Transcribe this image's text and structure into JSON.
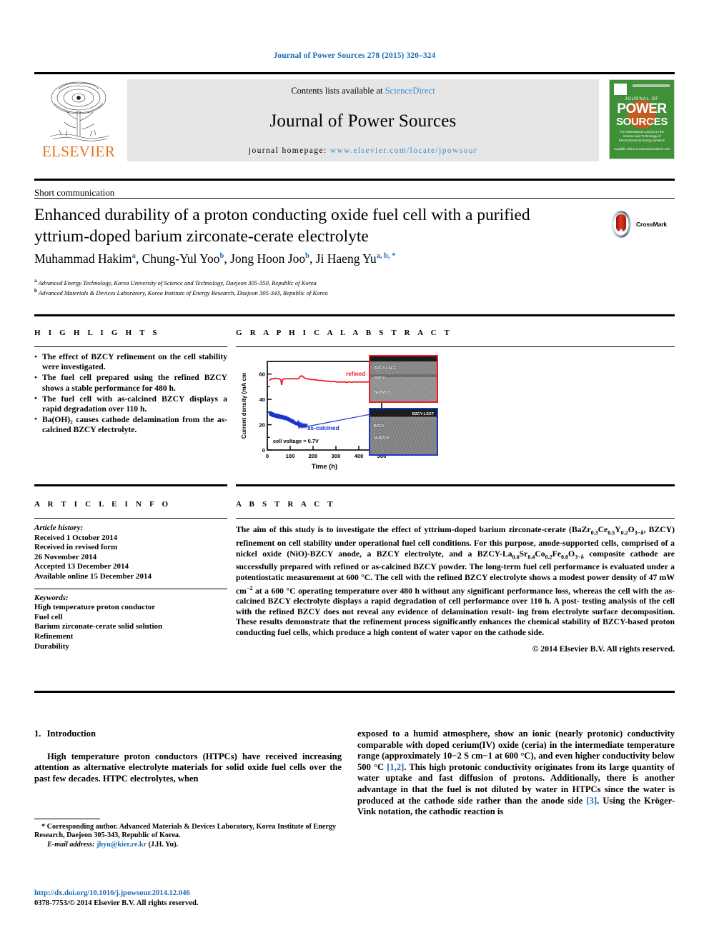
{
  "running_head": "Journal of Power Sources 278 (2015) 320–324",
  "masthead": {
    "publisher": "ELSEVIER",
    "contents_prefix": "Contents lists available at ",
    "contents_link": "ScienceDirect",
    "journal_name": "Journal of Power Sources",
    "homepage_prefix": "journal homepage: ",
    "homepage_url": "www.elsevier.com/locate/jpowsour",
    "cover": {
      "journal_of": "JOURNAL OF",
      "power": "POWER",
      "sources": "SOURCES",
      "subtitle": "The International Journal on the Science and Technology of Electrochemical Energy Systems",
      "footer": "Available online at www.sciencedirect.com"
    }
  },
  "article": {
    "category": "Short communication",
    "title": "Enhanced durability of a proton conducting oxide fuel cell with a purified yttrium-doped barium zirconate-cerate electrolyte",
    "crossmark_label": "CrossMark",
    "authors": [
      {
        "name": "Muhammad Hakim",
        "sup": "a"
      },
      {
        "name": "Chung-Yul Yoo",
        "sup": "b"
      },
      {
        "name": "Jong Hoon Joo",
        "sup": "b"
      },
      {
        "name": "Ji Haeng Yu",
        "sup": "a, b, *"
      }
    ],
    "affiliations": [
      {
        "marker": "a",
        "text": "Advanced Energy Technology, Korea University of Science and Technology, Daejeon 305-350, Republic of Korea"
      },
      {
        "marker": "b",
        "text": "Advanced Materials & Devices Laboratory, Korea Institute of Energy Research, Daejeon 305-343, Republic of Korea"
      }
    ]
  },
  "highlights": {
    "heading": "H I G H L I G H T S",
    "items": [
      "The effect of BZCY refinement on the cell stability were investigated.",
      "The fuel cell prepared using the refined BZCY shows a stable performance for 480 h.",
      "The fuel cell with as-calcined BZCY displays a rapid degradation over 110 h.",
      "Ba(OH)₂ causes cathode delamination from the as-calcined BZCY electrolyte."
    ]
  },
  "graphical_abstract": {
    "heading": "G R A P H I C A L   A B S T R A C T"
  },
  "article_info": {
    "heading": "A R T I C L E    I N F O",
    "history_label": "Article history:",
    "history": [
      "Received 1 October 2014",
      "Received in revised form",
      "26 November 2014",
      "Accepted 13 December 2014",
      "Available online 15 December 2014"
    ],
    "keywords_label": "Keywords:",
    "keywords": [
      "High temperature proton conductor",
      "Fuel cell",
      "Barium zirconate-cerate solid solution",
      "Refinement",
      "Durability"
    ]
  },
  "abstract": {
    "heading": "A B S T R A C T",
    "paragraphs": [
      "The aim of this study is to investigate the effect of yttrium-doped barium zirconate-cerate (BaZr0.3Ce0.5Y0.2O3−δ, BZCY) refinement on cell stability under operational fuel cell conditions. For this purpose, anode-supported cells, comprised of a nickel oxide (NiO)-BZCY anode, a BZCY electrolyte, and a BZCY-La0.6Sr0.4Co0.2Fe0.8O3−δ composite cathode are successfully prepared with refined or as-calcined BZCY powder. The long-term fuel cell performance is evaluated under a potentiostatic measurement at 600 °C. The cell with the refined BZCY electrolyte shows a modest power density of 47 mW cm−2 at a 600 °C operating temperature over 480 h without any significant performance loss, whereas the cell with the as-calcined BZCY electrolyte displays a rapid degradation of cell performance over 110 h. A post-testing analysis of the cell with the refined BZCY does not reveal any evidence of delamination resulting from electrolyte surface decomposition. These results demonstrate that the refinement process significantly enhances the chemical stability of BZCY-based proton conducting fuel cells, which produce a high content of water vapor on the cathode side."
    ],
    "copyright": "© 2014 Elsevier B.V. All rights reserved."
  },
  "introduction": {
    "number": "1.",
    "heading": "Introduction",
    "left_paragraph": "High temperature proton conductors (HTPCs) have received increasing attention as alternative electrolyte materials for solid oxide fuel cells over the past few decades. HTPC electrolytes, when",
    "right_paragraph_parts": [
      "exposed to a humid atmosphere, show an ionic (nearly protonic) conductivity comparable with doped cerium(IV) oxide (ceria) in the intermediate temperature range (approximately 10−2 S cm−1 at 600 °C), and even higher conductivity below 500 °C ",
      "[1,2]",
      ". This high protonic conductivity originates from its large quantity of water uptake and fast diffusion of protons. Additionally, there is another advantage in that the fuel is not diluted by water in HTPCs since the water is produced at the cathode side rather than the anode side ",
      "[3]",
      ". Using the Kröger-Vink notation, the cathodic reaction is"
    ]
  },
  "footnote": {
    "corresponding": "* Corresponding author. Advanced Materials & Devices Laboratory, Korea Institute of Energy Research, Daejeon 305-343, Republic of Korea.",
    "email_label": "E-mail address:",
    "email": "jhyu@kier.re.kr",
    "email_suffix": "(J.H. Yu)."
  },
  "footer": {
    "doi": "http://dx.doi.org/10.1016/j.jpowsour.2014.12.046",
    "issn_line": "0378-7753/© 2014 Elsevier B.V. All rights reserved."
  },
  "colors": {
    "link": "#1a6bb5",
    "elsevier_orange": "#E9711C",
    "refined_red": "#ee1c25",
    "ascalcined_blue": "#1a35cc",
    "cover_green": "#3f9038"
  },
  "chart_data": {
    "type": "line",
    "title": "",
    "xlabel": "Time (h)",
    "ylabel": "Current density (mA cm⁻²)",
    "xlim": [
      0,
      500
    ],
    "ylim": [
      0,
      70
    ],
    "xticks": [
      0,
      100,
      200,
      300,
      400,
      500
    ],
    "yticks": [
      0,
      20,
      40,
      60
    ],
    "grid": false,
    "annotation": "cell voltage = 0.7V",
    "legend_position": "inline",
    "series": [
      {
        "name": "refined",
        "color": "#ee1c25",
        "x": [
          0,
          10,
          20,
          30,
          40,
          50,
          60,
          70,
          80,
          90,
          100,
          120,
          140,
          160,
          165,
          180,
          200,
          220,
          240,
          260,
          280,
          300,
          320,
          340,
          360,
          380,
          400,
          420,
          440,
          460,
          480
        ],
        "values": [
          55,
          56,
          57,
          57,
          56,
          53,
          56,
          57,
          57,
          57,
          57,
          57,
          57,
          59,
          58,
          57,
          56,
          56,
          55,
          55,
          54,
          54,
          53,
          53,
          54,
          53,
          53,
          53,
          53,
          54,
          53
        ]
      },
      {
        "name": "as-calcined",
        "color": "#1a35cc",
        "x": [
          0,
          5,
          10,
          15,
          20,
          25,
          30,
          35,
          40,
          45,
          50,
          55,
          60,
          65,
          70,
          75,
          80,
          85,
          90,
          95,
          100,
          105,
          110
        ],
        "values": [
          30,
          29,
          28,
          28,
          27,
          27,
          26,
          26,
          26,
          25,
          25,
          24,
          24,
          23,
          23,
          22,
          22,
          21,
          21,
          20,
          20,
          20,
          20
        ]
      }
    ],
    "sem_images": [
      {
        "name": "refined-sem",
        "border_color": "#ee1c25",
        "labels": [
          "BZCY-LSCF",
          "BZCY",
          "Ni-BZCY"
        ]
      },
      {
        "name": "as-calcined-sem",
        "border_color": "#1a35cc",
        "labels": [
          "BZCY-LSCF",
          "BZCY",
          "Ni-BZCY"
        ]
      }
    ]
  }
}
